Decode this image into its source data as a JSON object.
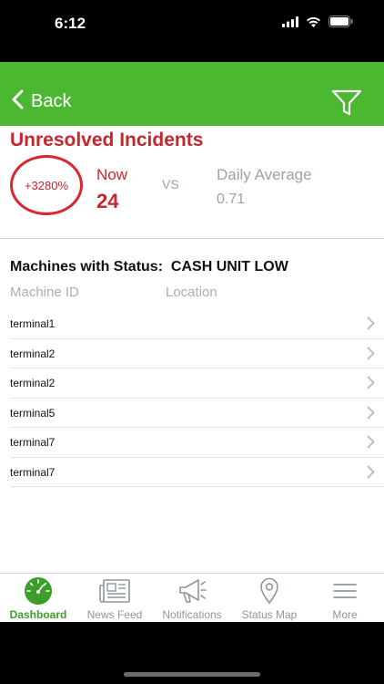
{
  "status_bar": {
    "time": "6:12"
  },
  "nav": {
    "back_label": "Back"
  },
  "incidents": {
    "title": "Unresolved Incidents",
    "percent": "+3280%",
    "now_label": "Now",
    "now_value": "24",
    "vs_label": "VS",
    "avg_label": "Daily Average",
    "avg_value": "0.71"
  },
  "machines": {
    "heading": "Machines with Status:  CASH UNIT LOW",
    "columns": {
      "machine_id": "Machine ID",
      "location": "Location"
    },
    "rows": [
      {
        "id": "terminal1"
      },
      {
        "id": "terminal2"
      },
      {
        "id": "terminal2"
      },
      {
        "id": "terminal5"
      },
      {
        "id": "terminal7"
      },
      {
        "id": "terminal7"
      }
    ]
  },
  "tabs": [
    {
      "label": "Dashboard",
      "icon": "speedometer-icon",
      "active": true
    },
    {
      "label": "News Feed",
      "icon": "newspaper-icon",
      "active": false
    },
    {
      "label": "Notifications",
      "icon": "megaphone-icon",
      "active": false
    },
    {
      "label": "Status Map",
      "icon": "map-pin-icon",
      "active": false
    },
    {
      "label": "More",
      "icon": "menu-icon",
      "active": false
    }
  ],
  "colors": {
    "brand_green": "#4cb832",
    "alert_red": "#c8262d",
    "muted_gray": "#9aa3ad"
  }
}
